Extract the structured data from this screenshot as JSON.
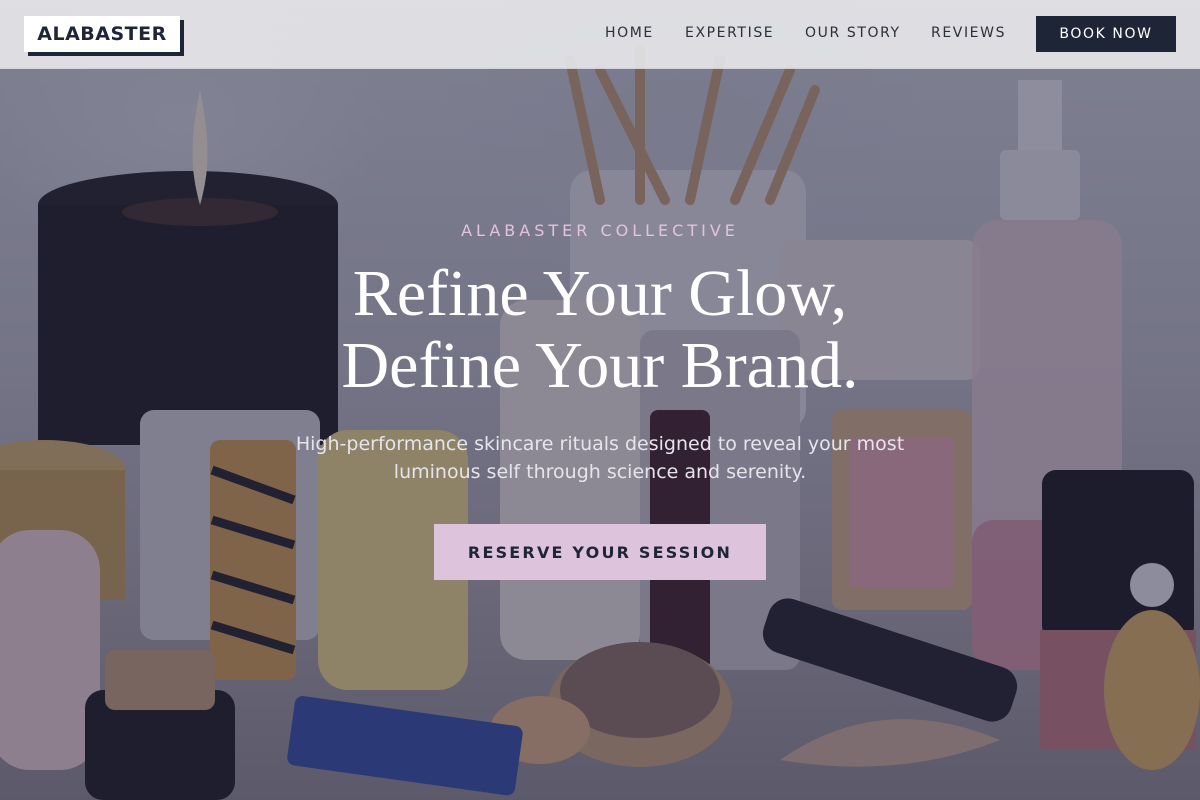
{
  "brand": {
    "logo_text": "ALABASTER"
  },
  "nav": {
    "items": [
      {
        "label": "HOME"
      },
      {
        "label": "EXPERTISE"
      },
      {
        "label": "OUR STORY"
      },
      {
        "label": "REVIEWS"
      }
    ],
    "cta_label": "BOOK NOW"
  },
  "hero": {
    "eyebrow": "ALABASTER COLLECTIVE",
    "headline_line1": "Refine Your Glow,",
    "headline_line2": "Define Your Brand.",
    "subtext": "High-performance skincare rituals designed to reveal your most luminous self through science and serenity.",
    "cta_label": "RESERVE YOUR SESSION",
    "background_image": "cosmetics-still-life-photo"
  },
  "colors": {
    "navy": "#1e2536",
    "accent_pink": "#dec3dd",
    "eyebrow_pink": "#e2c4dc",
    "header_bg": "#eeeef0"
  }
}
